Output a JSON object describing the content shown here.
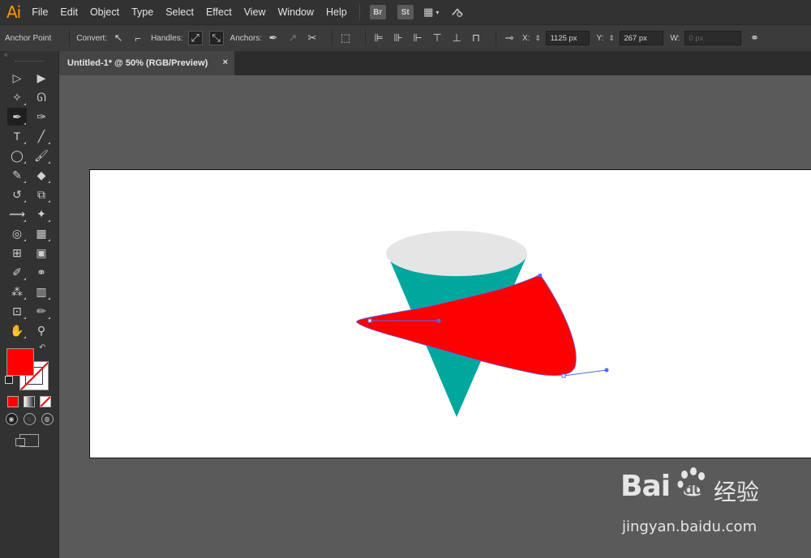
{
  "app": {
    "logo": "Ai"
  },
  "menubar": {
    "items": [
      "File",
      "Edit",
      "Object",
      "Type",
      "Select",
      "Effect",
      "View",
      "Window",
      "Help"
    ],
    "bridge_label": "Br",
    "stock_label": "St"
  },
  "controlbar": {
    "anchor_point": "Anchor Point",
    "convert_label": "Convert:",
    "handles_label": "Handles:",
    "anchors_label": "Anchors:",
    "x_label": "X:",
    "x_value": "1125 px",
    "y_label": "Y:",
    "y_value": "267 px",
    "w_label": "W:",
    "w_value": "0 px"
  },
  "toolbox": {
    "header": "«"
  },
  "document": {
    "tab_title": "Untitled-1* @ 50% (RGB/Preview)",
    "tab_close": "×"
  },
  "colors": {
    "fill": "#ff0000",
    "cone_body": "#00a79d",
    "cone_top": "#e5e5e5",
    "selection": "#4b6cf5",
    "pasteboard": "#5a5a5a",
    "artboard": "#ffffff"
  },
  "watermark": {
    "brand": "Bai",
    "brand_suffix": "du",
    "chinese": "经验",
    "url": "jingyan.baidu.com"
  }
}
